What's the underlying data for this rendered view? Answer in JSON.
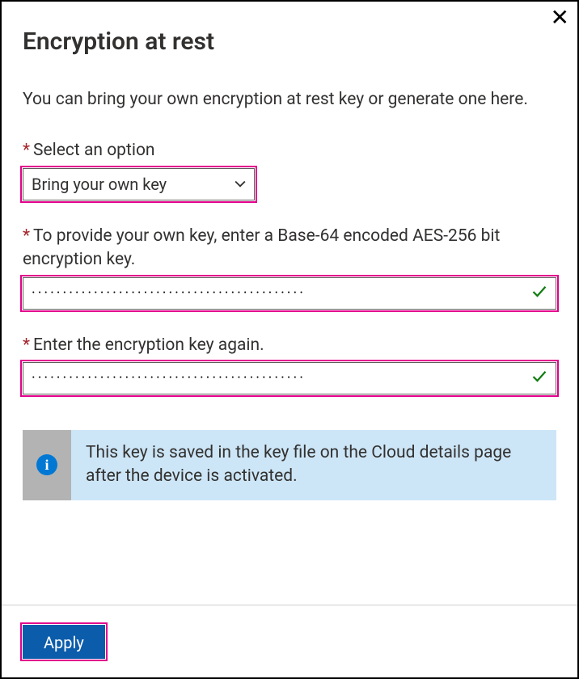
{
  "header": {
    "title": "Encryption at rest",
    "close_symbol": "✕"
  },
  "description": "You can bring your own encryption at rest key or generate one here.",
  "fields": {
    "option": {
      "label": "Select an option",
      "selected": "Bring your own key"
    },
    "key": {
      "label": "To provide your own key, enter a Base-64 encoded AES-256 bit encryption key.",
      "masked_value": "············································",
      "valid": true
    },
    "key_confirm": {
      "label": "Enter the encryption key again.",
      "masked_value": "············································",
      "valid": true
    }
  },
  "info": {
    "text": "This key is saved in the key file on the Cloud details page after the device is activated."
  },
  "footer": {
    "apply_label": "Apply"
  }
}
